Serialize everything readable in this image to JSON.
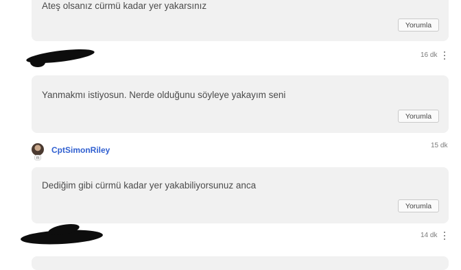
{
  "comments": [
    {
      "text": "Ateş olsanız cürmü kadar yer yakarsınız",
      "reply_label": "Yorumla"
    },
    {
      "time": "16 dk",
      "text": "Yanmakmı istiyosun. Nerde olduğunu söyleye yakayım seni",
      "reply_label": "Yorumla"
    },
    {
      "username": "CptSimonRiley",
      "time": "15 dk",
      "text": "Dediğim gibi cürmü kadar yer yakabiliyorsunuz anca",
      "reply_label": "Yorumla"
    },
    {
      "time": "14 dk"
    }
  ],
  "icons": {
    "more": "kebab-menu-icon",
    "avatar_badge": "m"
  }
}
